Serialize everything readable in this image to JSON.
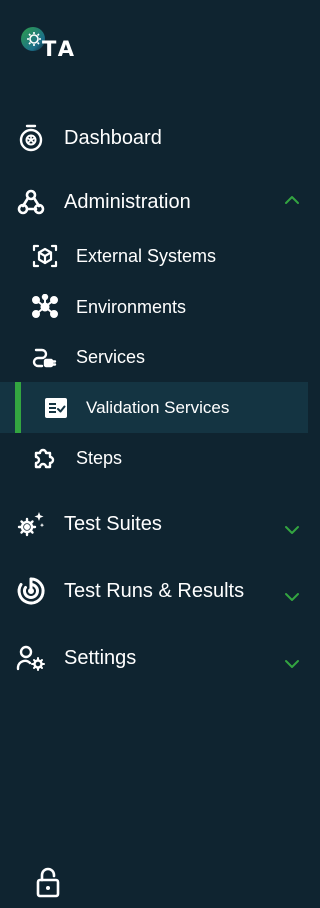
{
  "logo": {
    "text": "TA"
  },
  "nav": {
    "dashboard": {
      "label": "Dashboard",
      "icon": "stopwatch-icon"
    },
    "administration": {
      "label": "Administration",
      "icon": "webhook-icon",
      "expanded": true
    },
    "external_systems": {
      "label": "External Systems",
      "icon": "cube-scan-icon"
    },
    "environments": {
      "label": "Environments",
      "icon": "hub-nodes-icon"
    },
    "services": {
      "label": "Services",
      "icon": "plug-icon"
    },
    "validation_services": {
      "label": "Validation Services",
      "icon": "checklist-icon",
      "active": true
    },
    "steps": {
      "label": "Steps",
      "icon": "puzzle-icon"
    },
    "test_suites": {
      "label": "Test Suites",
      "icon": "gears-sparkle-icon",
      "expanded": false
    },
    "test_runs": {
      "label": "Test Runs & Results",
      "icon": "target-icon",
      "expanded": false
    },
    "settings": {
      "label": "Settings",
      "icon": "user-gear-icon",
      "expanded": false
    }
  },
  "footer": {
    "lock_icon": "unlock-icon"
  },
  "colors": {
    "background": "#0f2430",
    "active_background": "#143442",
    "accent": "#33a540",
    "text": "#ffffff"
  }
}
